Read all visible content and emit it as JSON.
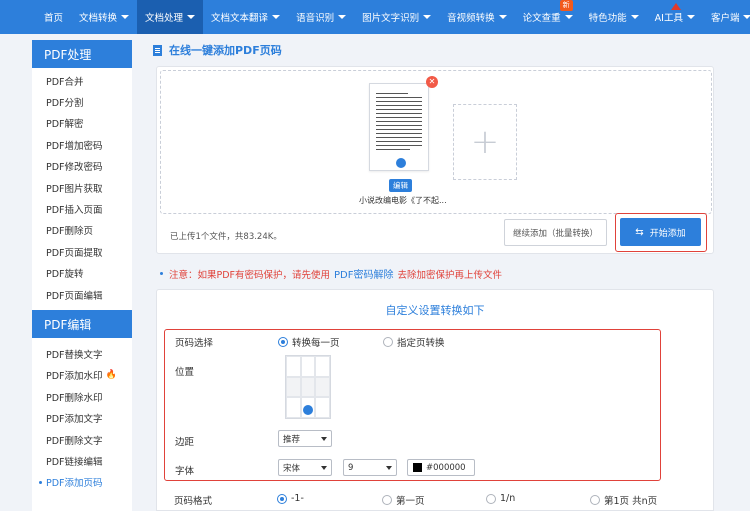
{
  "nav": {
    "items": [
      {
        "label": "首页",
        "caret": false
      },
      {
        "label": "文档转换",
        "caret": true
      },
      {
        "label": "文档处理",
        "caret": true
      },
      {
        "label": "文档文本翻译",
        "caret": true
      },
      {
        "label": "语音识别",
        "caret": true
      },
      {
        "label": "图片文字识别",
        "caret": true
      },
      {
        "label": "音视频转换",
        "caret": true
      },
      {
        "label": "论文查重",
        "caret": true
      },
      {
        "label": "特色功能",
        "caret": true
      },
      {
        "label": "AI工具",
        "caret": true
      },
      {
        "label": "客户端",
        "caret": true
      }
    ],
    "new_badge": "新"
  },
  "sidebar": {
    "section1": {
      "title": "PDF处理",
      "items": [
        "PDF合并",
        "PDF分割",
        "PDF解密",
        "PDF增加密码",
        "PDF修改密码",
        "PDF图片获取",
        "PDF插入页面",
        "PDF删除页",
        "PDF页面提取",
        "PDF旋转",
        "PDF页面编辑"
      ]
    },
    "section2": {
      "title": "PDF编辑",
      "items": [
        "PDF替换文字",
        "PDF添加水印",
        "PDF删除水印",
        "PDF添加文字",
        "PDF删除文字",
        "PDF链接编辑",
        "PDF添加页码"
      ]
    }
  },
  "main": {
    "title": "在线一键添加PDF页码"
  },
  "upload": {
    "edit_label": "编辑",
    "file_name": "小说改编电影《了不起...",
    "status": "已上传1个文件，共83.24K。",
    "more_button": "继续添加（批量转换）",
    "start_button": "开始添加"
  },
  "notice": {
    "prefix": "注意：如果PDF有密码保护，请先使用",
    "link": "PDF密码解除",
    "suffix": "去除加密保护再上传文件"
  },
  "settings": {
    "title": "自定义设置转换如下",
    "page_select_label": "页码选择",
    "page_select_options": [
      "转换每一页",
      "指定页转换"
    ],
    "position_label": "位置",
    "margin_label": "边距",
    "margin_value": "推荐",
    "font_label": "字体",
    "font_family": "宋体",
    "font_size": "9",
    "color_value": "#000000",
    "format_label": "页码格式",
    "format_options": [
      "-1-",
      "第一页",
      "1/n",
      "第1页 共n页"
    ]
  },
  "colors": {
    "primary": "#2d7fdb",
    "nav_active": "#1b5fb0",
    "highlight": "#e0423a"
  }
}
